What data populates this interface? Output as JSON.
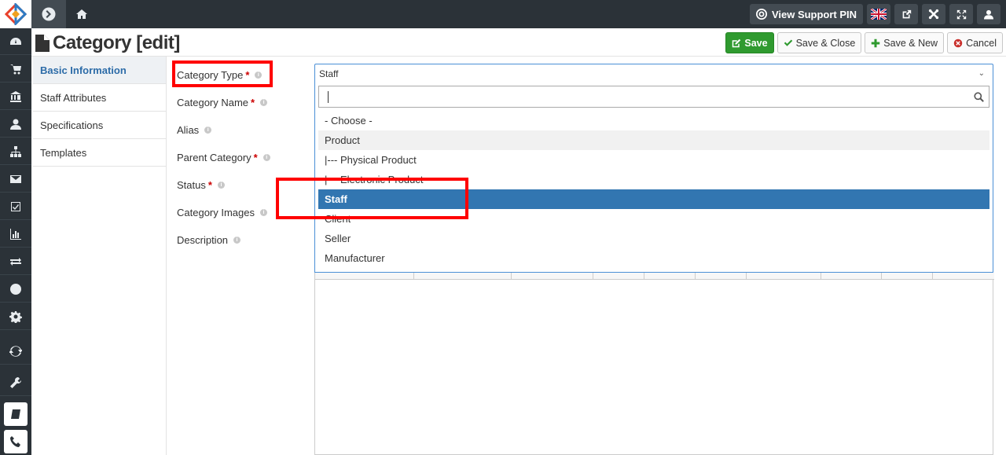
{
  "topbar": {
    "support_label": "View Support PIN",
    "language_flag": "uk-flag-icon"
  },
  "header": {
    "title": "Category [edit]"
  },
  "actions": {
    "save": "Save",
    "save_close": "Save & Close",
    "save_new": "Save & New",
    "cancel": "Cancel"
  },
  "subnav": [
    "Basic Information",
    "Staff Attributes",
    "Specifications",
    "Templates"
  ],
  "form": {
    "category_type": "Category Type",
    "category_name": "Category Name",
    "alias": "Alias",
    "parent_category": "Parent Category",
    "status": "Status",
    "category_images": "Category Images",
    "description": "Description",
    "required_mark": "*"
  },
  "select": {
    "value": "Staff",
    "search_value": ""
  },
  "options": [
    "- Choose -",
    "Product",
    "|--- Physical Product",
    "|--- Electronic Product",
    "Staff",
    "Client",
    "Seller",
    "Manufacturer"
  ],
  "colors": {
    "sidebar_bg": "#2b3238",
    "selected_option": "#3276b1",
    "save_button": "#2f9a2f",
    "annotation": "#ff0000"
  }
}
